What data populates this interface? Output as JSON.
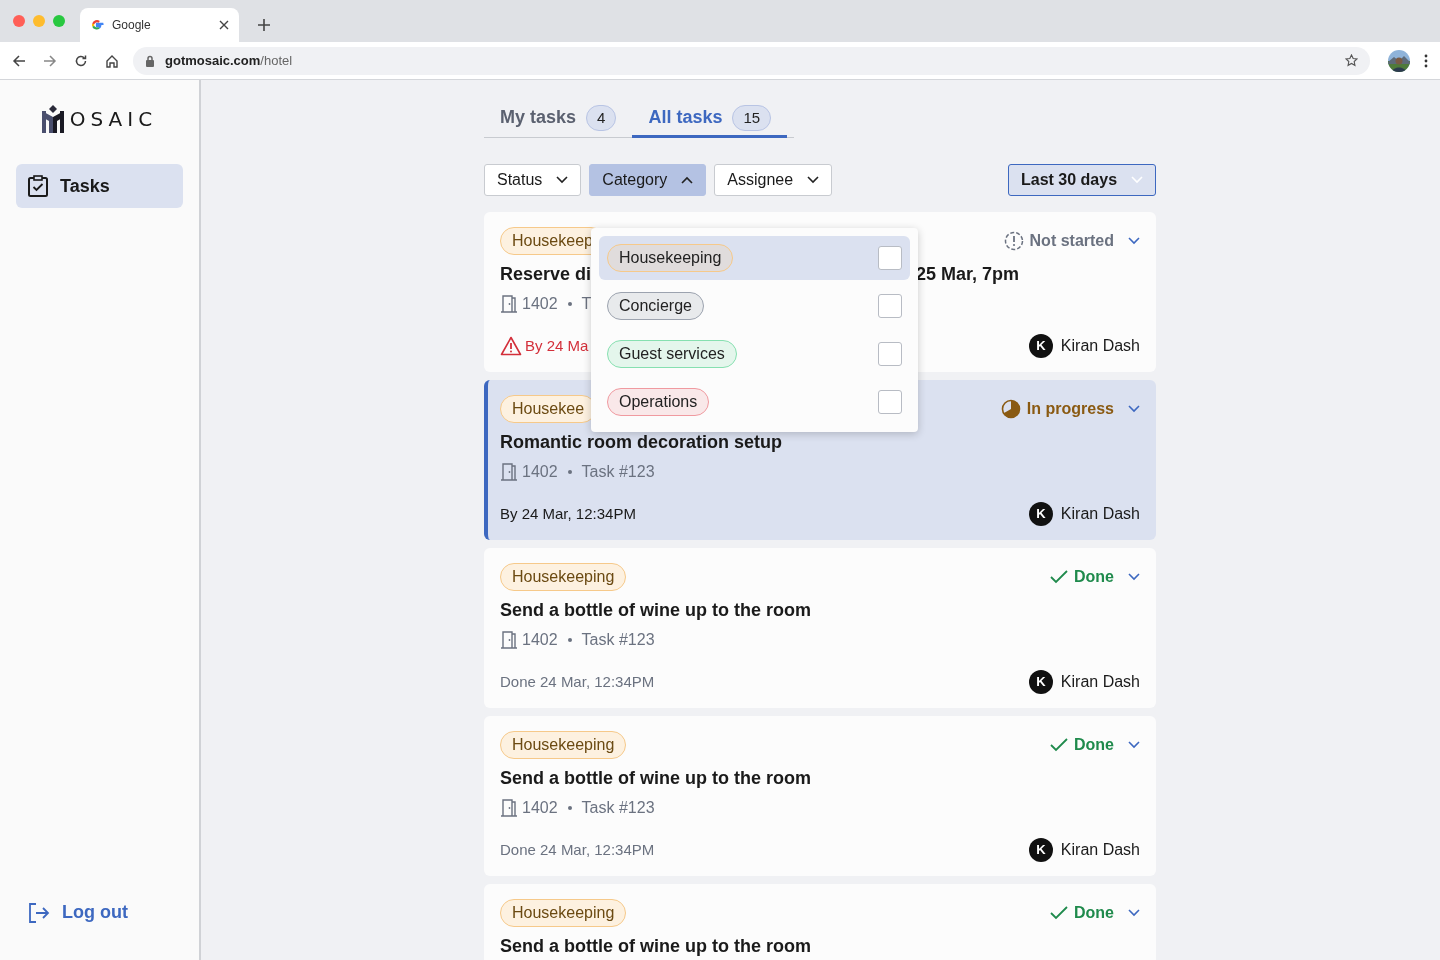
{
  "browser": {
    "tab_title": "Google",
    "url_host": "gotmosaic.com",
    "url_path": "/hotel"
  },
  "sidebar": {
    "logo_text": "OSAIC",
    "items": [
      {
        "label": "Tasks",
        "selected": true
      }
    ],
    "logout": "Log out"
  },
  "tabs": [
    {
      "label": "My tasks",
      "count": "4",
      "selected": false
    },
    {
      "label": "All tasks",
      "count": "15",
      "selected": true
    }
  ],
  "filters": [
    {
      "label": "Status",
      "open": false
    },
    {
      "label": "Category",
      "open": true
    },
    {
      "label": "Assignee",
      "open": false
    }
  ],
  "date_filter": "Last 30 days",
  "category_menu": [
    {
      "label": "Housekeeping",
      "color": "#f6c98a",
      "highlighted": true,
      "checked": false
    },
    {
      "label": "Concierge",
      "color": "#9ca3af",
      "highlighted": false,
      "checked": false
    },
    {
      "label": "Guest services",
      "color": "#86e0b0",
      "highlighted": false,
      "checked": false
    },
    {
      "label": "Operations",
      "color": "#f09aa0",
      "highlighted": false,
      "checked": false
    }
  ],
  "tasks": [
    {
      "category": "Housekeep",
      "kind": "not_started",
      "status_label": "Not started",
      "title": "Reserve di",
      "title_end": "25 Mar, 7pm",
      "room": "1402",
      "task_no": "T",
      "overdue": true,
      "deadline": "By 24 Ma",
      "assignee_initial": "K",
      "assignee": "Kiran Dash",
      "selected": false
    },
    {
      "category": "Housekee",
      "kind": "in_progress",
      "status_label": "In progress",
      "title": "Romantic room decoration setup",
      "room": "1402",
      "task_no": "Task #123",
      "overdue": false,
      "deadline": "By 24 Mar, 12:34PM",
      "assignee_initial": "K",
      "assignee": "Kiran Dash",
      "selected": true
    },
    {
      "category": "Housekeeping",
      "kind": "done",
      "status_label": "Done",
      "title": "Send a bottle of wine up to the room",
      "room": "1402",
      "task_no": "Task #123",
      "overdue": false,
      "deadline": "Done 24 Mar, 12:34PM",
      "assignee_initial": "K",
      "assignee": "Kiran Dash",
      "selected": false
    },
    {
      "category": "Housekeeping",
      "kind": "done",
      "status_label": "Done",
      "title": "Send a bottle of wine up to the room",
      "room": "1402",
      "task_no": "Task #123",
      "overdue": false,
      "deadline": "Done 24 Mar, 12:34PM",
      "assignee_initial": "K",
      "assignee": "Kiran Dash",
      "selected": false
    },
    {
      "category": "Housekeeping",
      "kind": "done",
      "status_label": "Done",
      "title": "Send a bottle of wine up to the room",
      "selected": false
    }
  ]
}
